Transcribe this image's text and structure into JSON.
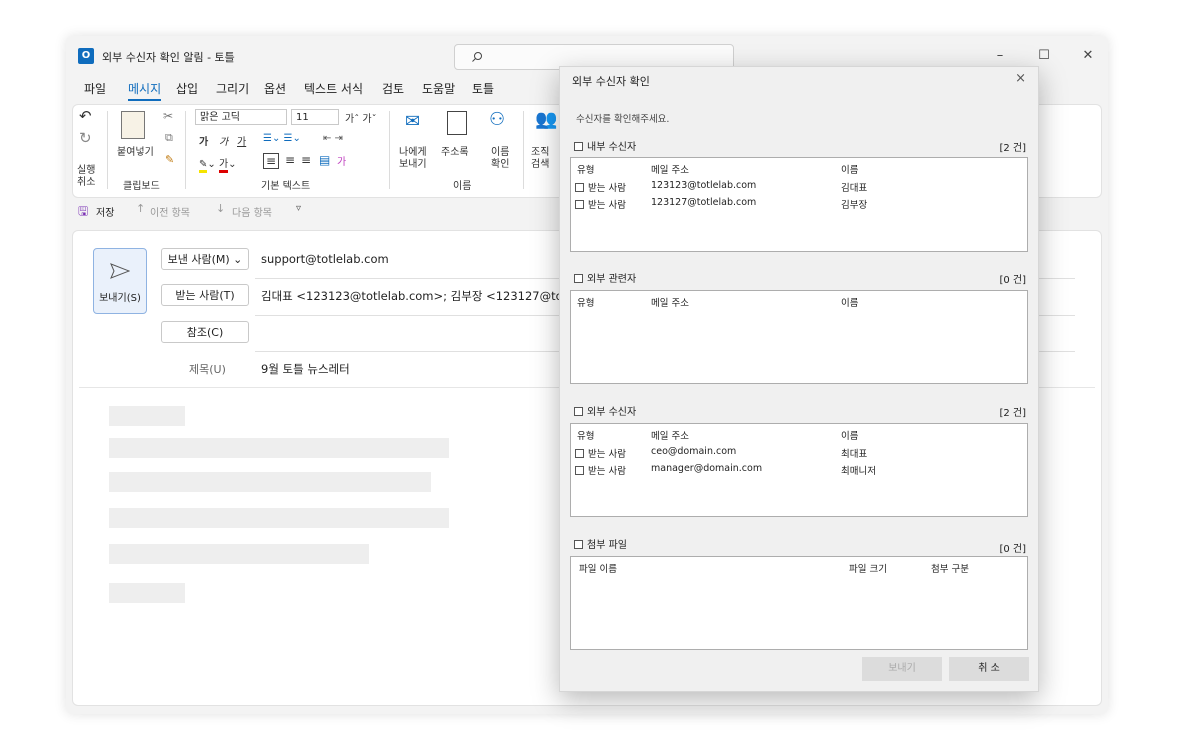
{
  "window": {
    "title": "외부 수신자 확인 알림 - 토틀"
  },
  "menu": [
    "파일",
    "메시지",
    "삽입",
    "그리기",
    "옵션",
    "텍스트 서식",
    "검토",
    "도움말",
    "토틀"
  ],
  "ribbon": {
    "undo": "실행\n취소",
    "undo_l1": "실행",
    "undo_l2": "취소",
    "paste": "붙여넣기",
    "clipboard": "클립보드",
    "font_name": "맑은 고딕",
    "font_size": "11",
    "basic_text": "기본 텍스트",
    "send_to_me_l1": "나에게",
    "send_to_me_l2": "보내기",
    "address_book": "주소록",
    "check_names_l1": "이름",
    "check_names_l2": "확인",
    "org_l1": "조직",
    "org_l2": "검색",
    "names_group": "이름"
  },
  "qat": {
    "save": "저장",
    "prev": "이전 항목",
    "next": "다음 항목"
  },
  "compose": {
    "send_label": "보내기(S)",
    "from_label": "보낸 사람(M)",
    "from_value": "support@totlelab.com",
    "to_label": "받는 사람(T)",
    "to_value": "김대표 <123123@totlelab.com>; 김부장 <123127@totlela",
    "cc_label": "참조(C)",
    "subject_label": "제목(U)",
    "subject_value": "9월 토틀 뉴스레터"
  },
  "dialog": {
    "title": "외부 수신자 확인",
    "close": "×",
    "prompt": "수신자를 확인해주세요.",
    "sections": {
      "internal": {
        "label": "내부 수신자",
        "count": "[2 건]",
        "headers": [
          "유형",
          "메일 주소",
          "이름"
        ],
        "rows": [
          {
            "type": "받는 사람",
            "email": "123123@totlelab.com",
            "name": "김대표"
          },
          {
            "type": "받는 사람",
            "email": "123127@totlelab.com",
            "name": "김부장"
          }
        ]
      },
      "related": {
        "label": "외부 관련자",
        "count": "[0 건]",
        "headers": [
          "유형",
          "메일 주소",
          "이름"
        ]
      },
      "external": {
        "label": "외부 수신자",
        "count": "[2 건]",
        "headers": [
          "유형",
          "메일 주소",
          "이름"
        ],
        "rows": [
          {
            "type": "받는 사람",
            "email": "ceo@domain.com",
            "name": "최대표"
          },
          {
            "type": "받는 사람",
            "email": "manager@domain.com",
            "name": "최매니저"
          }
        ]
      },
      "attachments": {
        "label": "첨부 파일",
        "count": "[0 건]",
        "headers": [
          "파일 이름",
          "파일 크기",
          "첨부 구분"
        ]
      }
    },
    "send_button": "보내기",
    "cancel_button": "취 소"
  }
}
